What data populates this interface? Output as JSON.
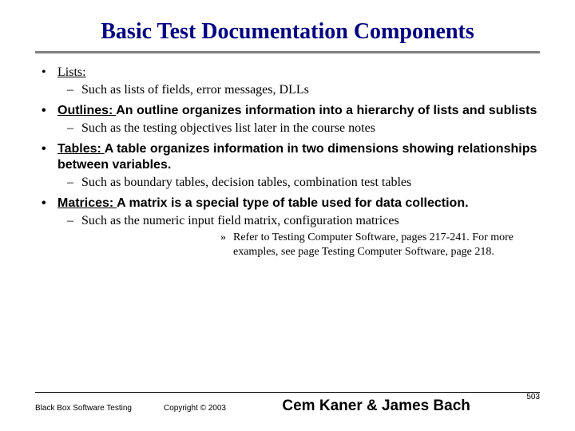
{
  "title": "Basic Test Documentation Components",
  "bullets": {
    "b1": {
      "term": "Lists:",
      "desc": "",
      "sub": "Such as lists of fields, error messages, DLLs"
    },
    "b2": {
      "term": "Outlines: ",
      "desc": "An outline organizes information into a hierarchy of lists and sublists",
      "sub": "Such as the testing objectives list later in the course notes"
    },
    "b3": {
      "term": "Tables: ",
      "desc": "A table organizes information in two dimensions showing relationships between variables.",
      "sub": "Such as boundary tables, decision tables, combination test tables"
    },
    "b4": {
      "term": "Matrices: ",
      "desc": "A matrix is a special type of table used for data collection.",
      "sub": "Such as the numeric input field matrix, configuration matrices"
    }
  },
  "reference": "Refer to Testing Computer Software, pages 217-241. For more examples, see page Testing Computer Software, page 218.",
  "footer": {
    "course": "Black Box Software Testing",
    "copyright": "Copyright © 2003",
    "authors": "Cem Kaner & James Bach",
    "page": "503"
  }
}
